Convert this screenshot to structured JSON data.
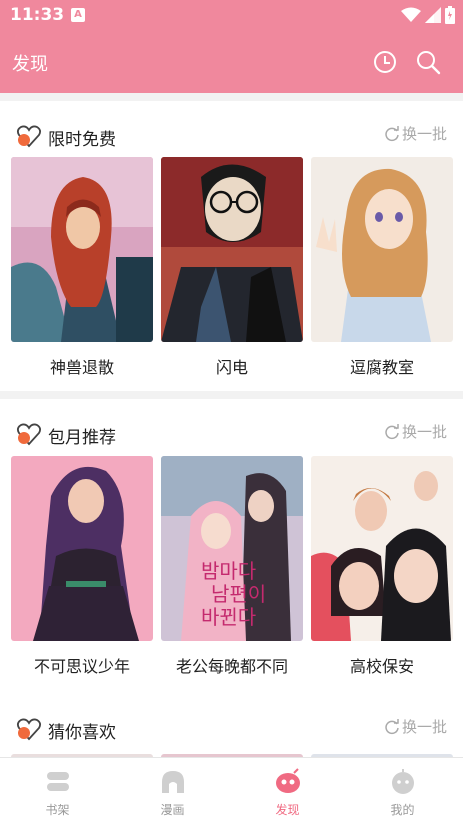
{
  "status_bar": {
    "time": "11:33",
    "notification_glyph": "A"
  },
  "app_bar": {
    "title": "发现",
    "history_icon": "clock-icon",
    "search_icon": "search-icon"
  },
  "sections": [
    {
      "title": "限时免费",
      "refresh_label": "换一批",
      "items": [
        {
          "title": "神兽退散",
          "cover": "red-haired-warrior-cover"
        },
        {
          "title": "闪电",
          "cover": "glasses-man-cover"
        },
        {
          "title": "逗腐教室",
          "cover": "blonde-girl-cover"
        }
      ]
    },
    {
      "title": "包月推荐",
      "refresh_label": "换一批",
      "items": [
        {
          "title": "不可思议少年",
          "cover": "purple-haired-woman-cover"
        },
        {
          "title": "老公每晚都不同",
          "cover": "couple-cover",
          "cover_text": [
            "밤마다",
            "남편이",
            "바뀐다"
          ]
        },
        {
          "title": "高校保安",
          "cover": "schoolgirls-cover"
        }
      ]
    },
    {
      "title": "猜你喜欢",
      "refresh_label": "换一批",
      "items": []
    }
  ],
  "tab_bar": {
    "tabs": [
      {
        "label": "书架",
        "icon": "bookshelf-icon",
        "active": false
      },
      {
        "label": "漫画",
        "icon": "comic-icon",
        "active": false
      },
      {
        "label": "发现",
        "icon": "discover-icon",
        "active": true
      },
      {
        "label": "我的",
        "icon": "profile-icon",
        "active": false
      }
    ]
  },
  "colors": {
    "primary": "#f0889d",
    "accent_active": "#f06a82",
    "section_gap": "#f2f2f2",
    "muted_text": "#aaaaaa"
  }
}
